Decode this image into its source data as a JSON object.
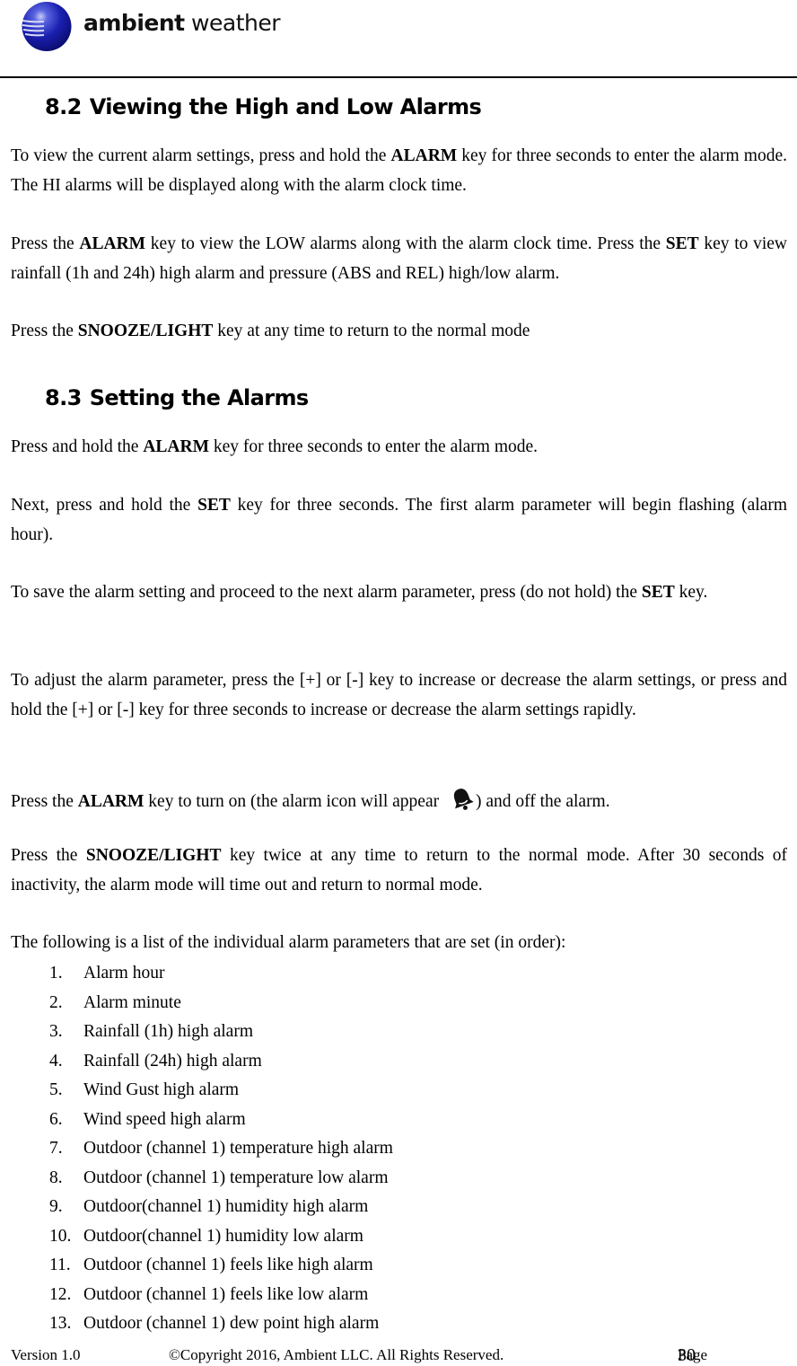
{
  "header": {
    "logo_bold": "ambient",
    "logo_light": " weather",
    "logo_icon": "globe-logo-icon",
    "brand_color": "#1a1fb0"
  },
  "section_82": {
    "number": "8.2",
    "title": "Viewing the High and Low Alarms",
    "p1": {
      "t1": "To view the current alarm settings, press and hold the ",
      "b1": "ALARM",
      "t2": " key for three seconds to enter the alarm mode. The HI alarms will be displayed along with the alarm clock time."
    },
    "p2": {
      "t1": "Press the ",
      "b1": "ALARM",
      "t2": " key to view the LOW alarms along with the alarm clock time. Press the ",
      "b2": "SET",
      "t3": " key to view rainfall (1h and 24h) high alarm and pressure (ABS and REL) high/low alarm."
    },
    "p3": {
      "t1": "Press the ",
      "b1": "SNOOZE/LIGHT",
      "t2": " key at any time to return to the normal mode"
    }
  },
  "section_83": {
    "number": "8.3",
    "title": "Setting the Alarms",
    "p1": {
      "t1": "Press and hold the ",
      "b1": "ALARM",
      "t2": " key for three seconds to enter the alarm mode."
    },
    "p2": {
      "t1": "Next, press and hold the ",
      "b1": "SET",
      "t2": " key for three seconds. The first alarm parameter will begin flashing (alarm hour)."
    },
    "p3": {
      "t1": "To save the alarm setting and proceed to the next alarm parameter, press (do not hold) the ",
      "b1": "SET",
      "t2": " key."
    },
    "p4": {
      "t1": "To adjust the alarm parameter, press the [+] or [-] key to increase or decrease the alarm settings, or press and hold the [+] or [-] key for three seconds to increase or decrease the alarm settings rapidly."
    },
    "p5": {
      "t1": "Press the ",
      "b1": "ALARM",
      "t2": " key to turn on (the alarm icon will appear ",
      "icon": "alarm-bell-icon",
      "t3": ") and off the alarm."
    },
    "p6": {
      "t1": "Press the ",
      "b1": "SNOOZE/LIGHT",
      "t2": " key twice at any time to return to the normal mode. After 30 seconds of inactivity, the alarm mode will time out and return to normal mode."
    },
    "p7": {
      "t1": "The following is a list of the individual alarm parameters that are set (in order):"
    },
    "list": [
      {
        "num": "1.",
        "text": "Alarm hour"
      },
      {
        "num": "2.",
        "text": "Alarm minute"
      },
      {
        "num": "3.",
        "text": "Rainfall (1h) high alarm"
      },
      {
        "num": "4.",
        "text": "Rainfall (24h) high alarm"
      },
      {
        "num": "5.",
        "text": "Wind Gust high alarm"
      },
      {
        "num": "6.",
        "text": "Wind speed high alarm"
      },
      {
        "num": "7.",
        "text": "Outdoor (channel 1) temperature high alarm"
      },
      {
        "num": "8.",
        "text": "Outdoor (channel 1) temperature low alarm"
      },
      {
        "num": "9.",
        "text": "Outdoor(channel 1) humidity high alarm"
      },
      {
        "num": "10.",
        "text": "Outdoor(channel 1) humidity low alarm"
      },
      {
        "num": "11.",
        "text": "Outdoor (channel 1) feels like high alarm"
      },
      {
        "num": "12.",
        "text": "Outdoor (channel 1) feels like low alarm"
      },
      {
        "num": "13.",
        "text": "Outdoor (channel 1) dew point high alarm"
      }
    ]
  },
  "footer": {
    "version": "Version 1.0",
    "copyright": "©Copyright 2016, Ambient LLC. All Rights Reserved.",
    "page_label": "Page ",
    "page_number": "30"
  }
}
